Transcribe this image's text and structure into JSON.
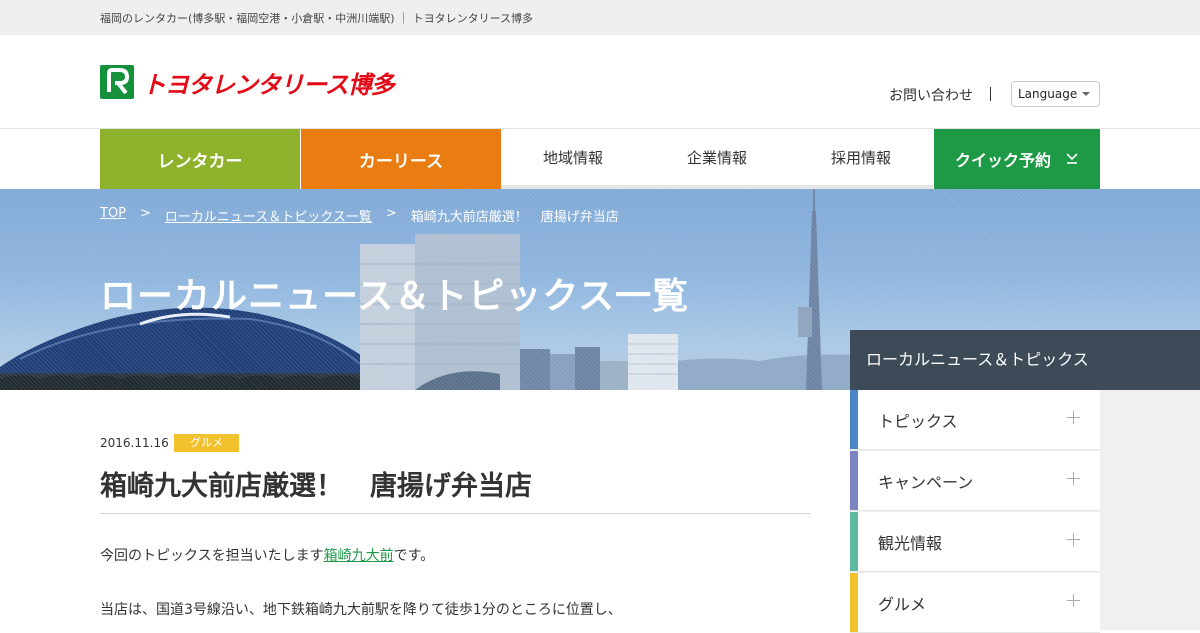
{
  "topbar": {
    "text": "福岡のレンタカー(博多駅・福岡空港・小倉駅・中洲川端駅) ｜ トヨタレンタリース博多"
  },
  "header": {
    "logo_text": "トヨタレンタリース博多",
    "contact": "お問い合わせ",
    "language": "Language"
  },
  "nav": {
    "rentacar": "レンタカー",
    "carlease": "カーリース",
    "area": "地域情報",
    "corporate": "企業情報",
    "recruit": "採用情報",
    "quick": "クイック予約"
  },
  "breadcrumb": {
    "top": "TOP",
    "sep": ">",
    "list": "ローカルニュース＆トピックス一覧",
    "current": "箱崎九大前店厳選！　唐揚げ弁当店"
  },
  "hero": {
    "title": "ローカルニュース＆トピックス一覧"
  },
  "post": {
    "date": "2016.11.16",
    "tag": "グルメ",
    "title": "箱崎九大前店厳選！　唐揚げ弁当店",
    "p1_before": "今回のトピックスを担当いたします",
    "p1_link": "箱崎九大前",
    "p1_after": "です。",
    "p2": "当店は、国道3号線沿い、地下鉄箱崎九大前駅を降りて徒歩1分のところに位置し、"
  },
  "sidebar": {
    "heading": "ローカルニュース＆トピックス",
    "items": [
      {
        "label": "トピックス",
        "color": "#4a86c8"
      },
      {
        "label": "キャンペーン",
        "color": "#7b84c0"
      },
      {
        "label": "観光情報",
        "color": "#5bb9a4"
      },
      {
        "label": "グルメ",
        "color": "#f2c12e"
      }
    ]
  },
  "colors": {
    "rentacar": "#8fb22d",
    "carlease": "#ea7d12",
    "quick": "#1e9a47",
    "logo_red": "#e20b17",
    "sidebar_head": "#3d4a57"
  }
}
